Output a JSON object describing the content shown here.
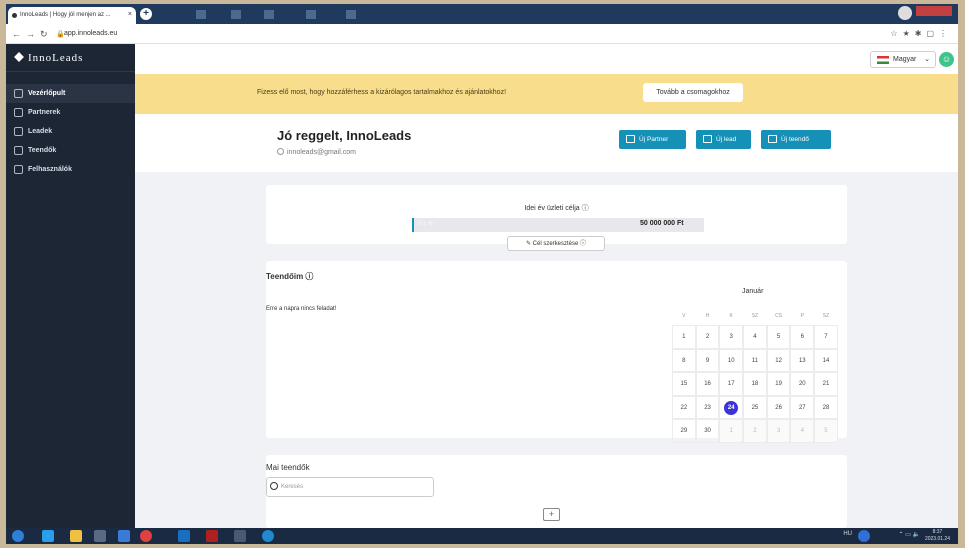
{
  "browser": {
    "tab_title": "InnoLeads | Hogy jól menjen az ...",
    "tab_close": "×",
    "new_tab": "+",
    "url": "app.innoleads.eu"
  },
  "sidebar": {
    "brand": "InnoLeads",
    "items": [
      {
        "label": "Vezérlőpult",
        "icon": "home-icon"
      },
      {
        "label": "Partnerek",
        "icon": "users-icon"
      },
      {
        "label": "Leadek",
        "icon": "inbox-icon"
      },
      {
        "label": "Teendők",
        "icon": "calendar-icon"
      },
      {
        "label": "Felhasználók",
        "icon": "user-icon"
      }
    ]
  },
  "topbar": {
    "language": "Magyar"
  },
  "banner": {
    "text": "Fizess elő most, hogy hozzáférhess a kizárólagos tartalmakhoz és ajánlatokhoz!",
    "button": "Tovább a csomagokhoz"
  },
  "header": {
    "greeting": "Jó reggelt, InnoLeads",
    "email": "innoleads@gmail.com",
    "buttons": [
      "Új Partner",
      "Új lead",
      "Új teendő"
    ]
  },
  "goal": {
    "label": "Idei év üzleti célja ⓘ",
    "percent_label": "0.1 %",
    "progress": 0.0,
    "amount": "50 000 000 Ft",
    "edit_button": "Cél szerkesztése ⓘ"
  },
  "todos": {
    "title": "Teendőim ⓘ",
    "empty_text": "Erre a napra nincs feladat!",
    "calendar": {
      "month": "Január",
      "weekdays": [
        "V",
        "H",
        "K",
        "SZ",
        "CS",
        "P",
        "SZ"
      ],
      "weeks": [
        [
          "1",
          "2",
          "3",
          "4",
          "5",
          "6",
          "7"
        ],
        [
          "8",
          "9",
          "10",
          "11",
          "12",
          "13",
          "14"
        ],
        [
          "15",
          "16",
          "17",
          "18",
          "19",
          "20",
          "21"
        ],
        [
          "22",
          "23",
          "24",
          "25",
          "26",
          "27",
          "28"
        ],
        [
          "29",
          "30",
          "1",
          "2",
          "3",
          "4",
          "5"
        ]
      ],
      "today": "24"
    }
  },
  "today_tasks": {
    "title": "Mai teendők",
    "search_placeholder": "Keresés"
  },
  "taskbar": {
    "time": "8:37",
    "date": "2023.01.24",
    "lang": "HU"
  }
}
